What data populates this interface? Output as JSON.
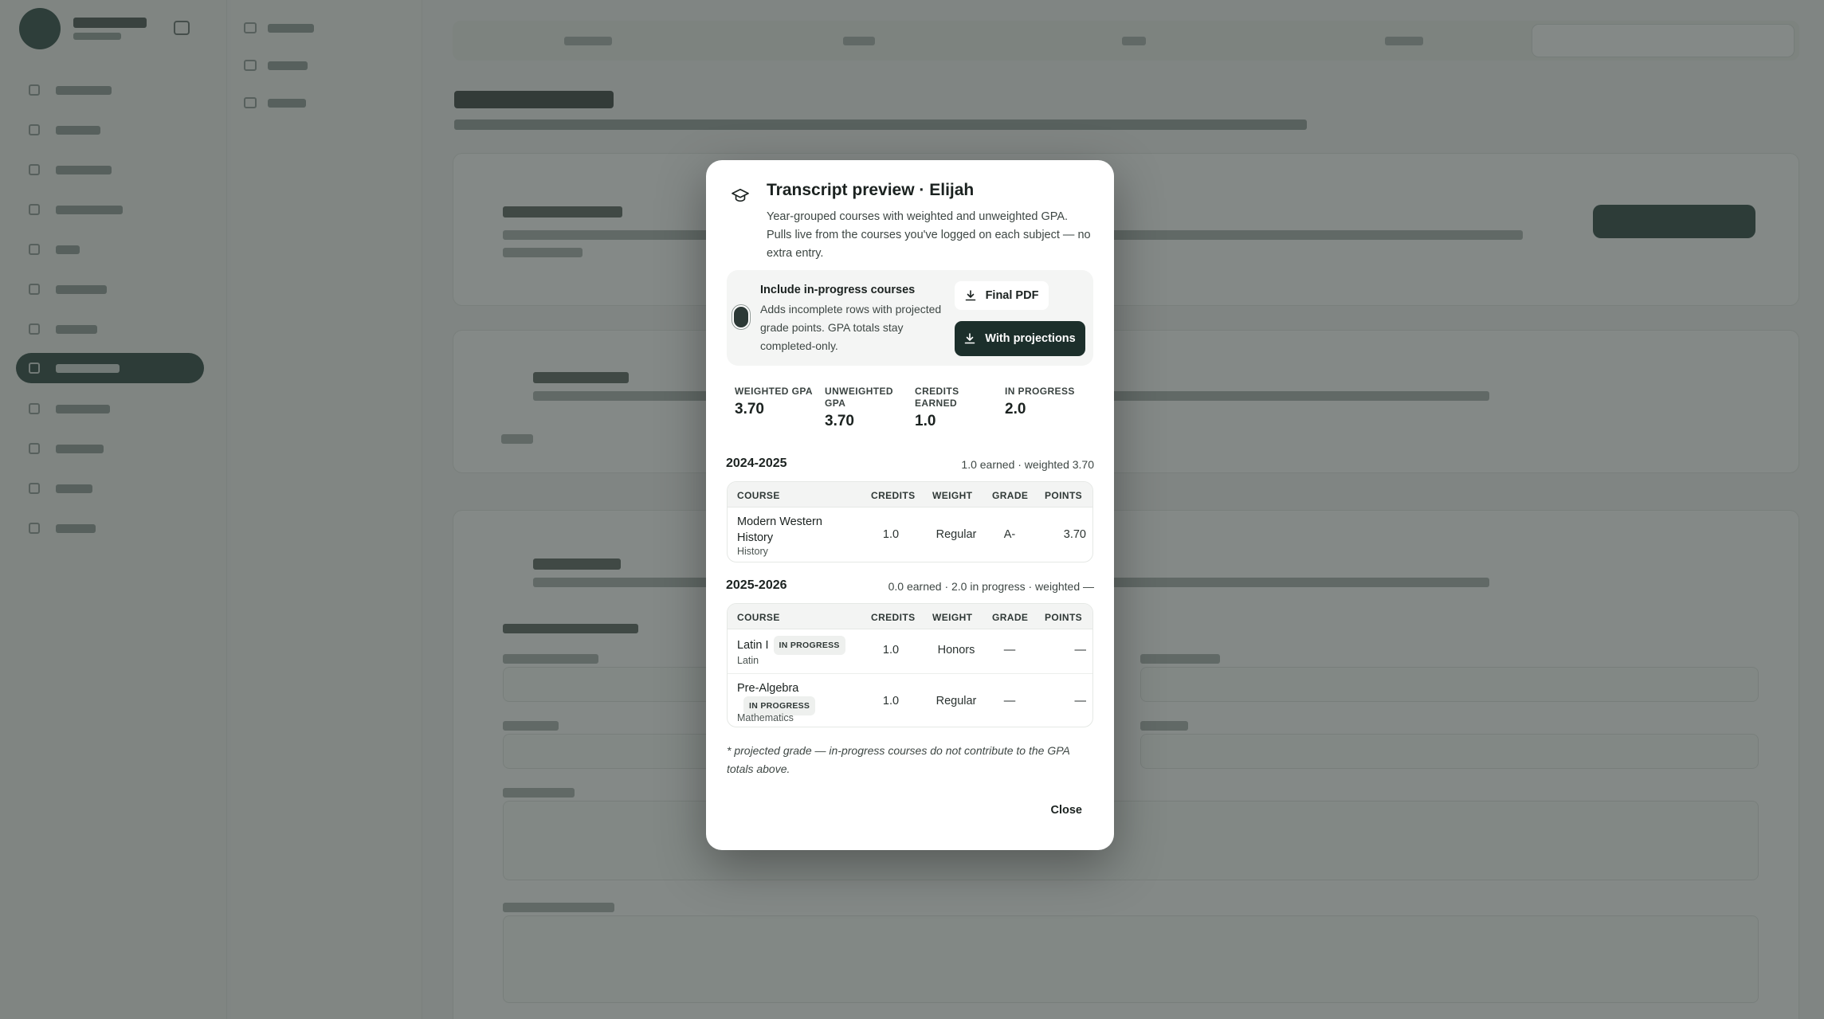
{
  "modal": {
    "title": "Transcript preview · Elijah",
    "description": "Year-grouped courses with weighted and unweighted GPA. Pulls live from the courses you've logged on each subject — no extra entry.",
    "option": {
      "title": "Include in-progress courses",
      "description": "Adds incomplete rows with projected grade points. GPA totals stay completed-only.",
      "enabled": true
    },
    "buttons": {
      "final_pdf": "Final PDF",
      "with_projections": "With projections",
      "close": "Close"
    },
    "stats": [
      {
        "label": "WEIGHTED GPA",
        "value": "3.70"
      },
      {
        "label": "UNWEIGHTED GPA",
        "value": "3.70"
      },
      {
        "label": "CREDITS EARNED",
        "value": "1.0"
      },
      {
        "label": "IN PROGRESS",
        "value": "2.0"
      }
    ],
    "table_headers": {
      "course": "COURSE",
      "credits": "CREDITS",
      "weight": "WEIGHT",
      "grade": "GRADE",
      "points": "POINTS"
    },
    "years": [
      {
        "year": "2024-2025",
        "summary": "1.0 earned · weighted 3.70",
        "courses": [
          {
            "name": "Modern Western History",
            "subject": "History",
            "badge": "",
            "credits": "1.0",
            "weight": "Regular",
            "grade": "A-",
            "points": "3.70"
          }
        ]
      },
      {
        "year": "2025-2026",
        "summary": "0.0 earned · 2.0 in progress · weighted —",
        "courses": [
          {
            "name": "Latin I",
            "subject": "Latin",
            "badge": "IN PROGRESS",
            "credits": "1.0",
            "weight": "Honors",
            "grade": "—",
            "points": "—"
          },
          {
            "name": "Pre-Algebra",
            "subject": "Mathematics",
            "badge": "IN PROGRESS",
            "credits": "1.0",
            "weight": "Regular",
            "grade": "—",
            "points": "—"
          }
        ]
      }
    ],
    "footnote": "* projected grade — in-progress courses do not contribute to the GPA totals above."
  },
  "icons": {
    "header": "graduation-cap-icon",
    "download": "download-icon"
  },
  "colors": {
    "primary_dark": "#1c2f2b",
    "scrim": "#38403d"
  }
}
